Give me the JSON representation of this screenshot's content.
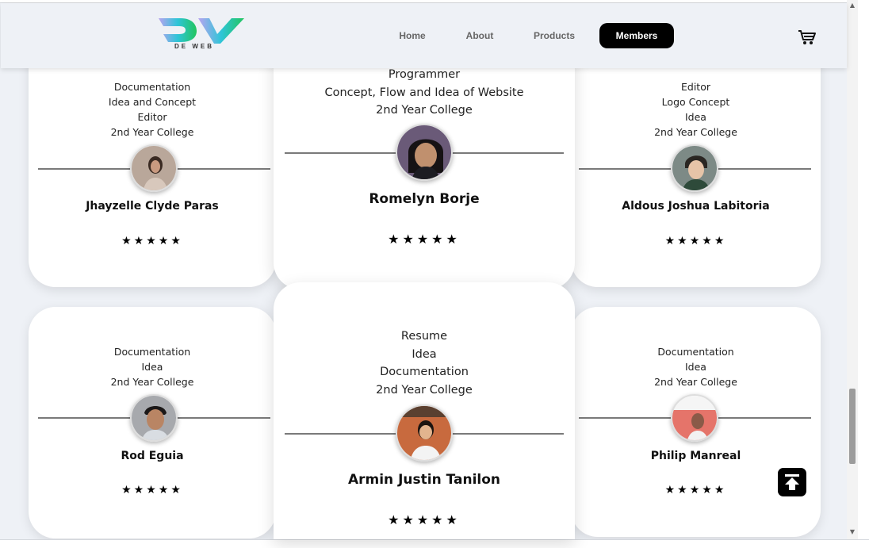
{
  "header": {
    "logo_text": "DE WEB",
    "nav": {
      "home": "Home",
      "about": "About",
      "products": "Products",
      "members": "Members"
    },
    "cart_icon": "cart-icon"
  },
  "members": [
    {
      "name": "Jhayzelle Clyde Paras",
      "roles": [
        "Documentation",
        "Idea and Concept",
        "Editor",
        "2nd Year College"
      ],
      "stars": "★★★★★"
    },
    {
      "name": "Romelyn Borje",
      "roles": [
        "Programmer",
        "Concept, Flow and Idea of Website",
        "2nd Year College"
      ],
      "stars": "★★★★★"
    },
    {
      "name": "Aldous Joshua Labitoria",
      "roles": [
        "Editor",
        "Logo Concept",
        "Idea",
        "2nd Year College"
      ],
      "stars": "★★★★★"
    },
    {
      "name": "Rod Eguia",
      "roles": [
        "Documentation",
        "Idea",
        "2nd Year College"
      ],
      "stars": "★★★★★"
    },
    {
      "name": "Armin Justin Tanilon",
      "roles": [
        "Resume",
        "Idea",
        "Documentation",
        "2nd Year College"
      ],
      "stars": "★★★★★"
    },
    {
      "name": "Philip Manreal",
      "roles": [
        "Documentation",
        "Idea",
        "2nd Year College"
      ],
      "stars": "★★★★★"
    }
  ],
  "scroll_top_icon": "arrow-up-to-top-icon",
  "colors": {
    "background": "#eef1f6",
    "card": "#ffffff",
    "accent_black": "#000000",
    "logo_gradient": [
      "#a78bfa",
      "#22d3ee",
      "#22c55e"
    ]
  }
}
